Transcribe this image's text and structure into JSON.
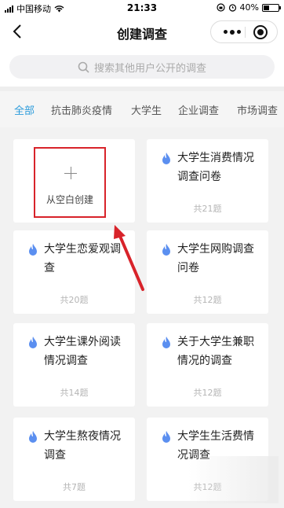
{
  "status_bar": {
    "carrier": "中国移动",
    "time": "21:33",
    "battery": "40%"
  },
  "nav": {
    "title": "创建调查"
  },
  "search": {
    "placeholder": "搜索其他用户公开的调查"
  },
  "tabs": [
    {
      "label": "全部",
      "active": true
    },
    {
      "label": "抗击肺炎疫情",
      "active": false
    },
    {
      "label": "大学生",
      "active": false
    },
    {
      "label": "企业调查",
      "active": false
    },
    {
      "label": "市场调查",
      "active": false
    }
  ],
  "create_card": {
    "label": "从空白创建"
  },
  "templates": [
    {
      "title": "大学生消费情况调查问卷",
      "count": "共21题"
    },
    {
      "title": "大学生恋爱观调查",
      "count": "共20题"
    },
    {
      "title": "大学生网购调查问卷",
      "count": "共12题"
    },
    {
      "title": "大学生课外阅读情况调查",
      "count": "共14题"
    },
    {
      "title": "关于大学生兼职情况的调查",
      "count": "共12题"
    },
    {
      "title": "大学生熬夜情况调查",
      "count": "共7题"
    },
    {
      "title": "大学生生活费情况调查",
      "count": "共12题"
    }
  ],
  "colors": {
    "accent": "#2b9bdb",
    "fire_icon": "#5b8ff0",
    "highlight": "#d8232a"
  }
}
